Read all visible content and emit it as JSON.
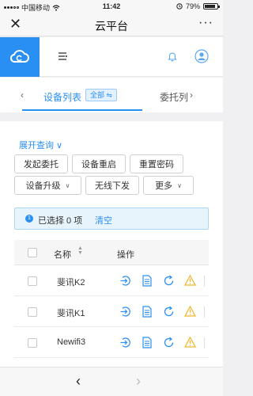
{
  "status_bar": {
    "carrier": "中国移动",
    "network_icon": "wifi-icon",
    "time": "11:42",
    "battery_percent": "79%",
    "battery_level": 0.79
  },
  "nav_bar": {
    "close_icon": "close-icon",
    "title": "云平台",
    "more_label": "···"
  },
  "app_header": {
    "logo_icon": "cloud-icon",
    "menu_icon": "menu-toggle-icon",
    "bell_icon": "bell-icon",
    "user_icon": "user-icon"
  },
  "tabs": {
    "prev_label": "‹",
    "active_label": "设备列表",
    "filter_badge": "全部 ⇋",
    "other_label": "委托列",
    "next_label": "›"
  },
  "toolbar": {
    "expand_label": "展开查询 ∨",
    "buttons_row1": [
      "发起委托",
      "设备重启",
      "重置密码"
    ],
    "buttons_row2": [
      {
        "label": "设备升级",
        "has_dropdown": true
      },
      {
        "label": "无线下发",
        "has_dropdown": false
      },
      {
        "label": "更多",
        "has_dropdown": true
      }
    ],
    "dropdown_chevron": "∨"
  },
  "selection": {
    "info_icon": "info-icon",
    "info_symbol": "1",
    "text": "已选择 0 项",
    "clear_label": "清空"
  },
  "table": {
    "col_name": "名称",
    "col_ops": "操作",
    "sort_icon": "sort-icon",
    "sort_symbol": "▲\n▼",
    "rows": [
      {
        "name": "斐讯K2"
      },
      {
        "name": "斐讯K1"
      },
      {
        "name": "Newifi3"
      }
    ],
    "op_icons": [
      "login-icon",
      "document-icon",
      "refresh-icon",
      "warning-icon"
    ]
  },
  "bottom_bar": {
    "back_label": "‹",
    "forward_label": "›"
  },
  "colors": {
    "accent": "#2a8ff2",
    "warning": "#f5b82e",
    "background": "#f0f0f2"
  }
}
